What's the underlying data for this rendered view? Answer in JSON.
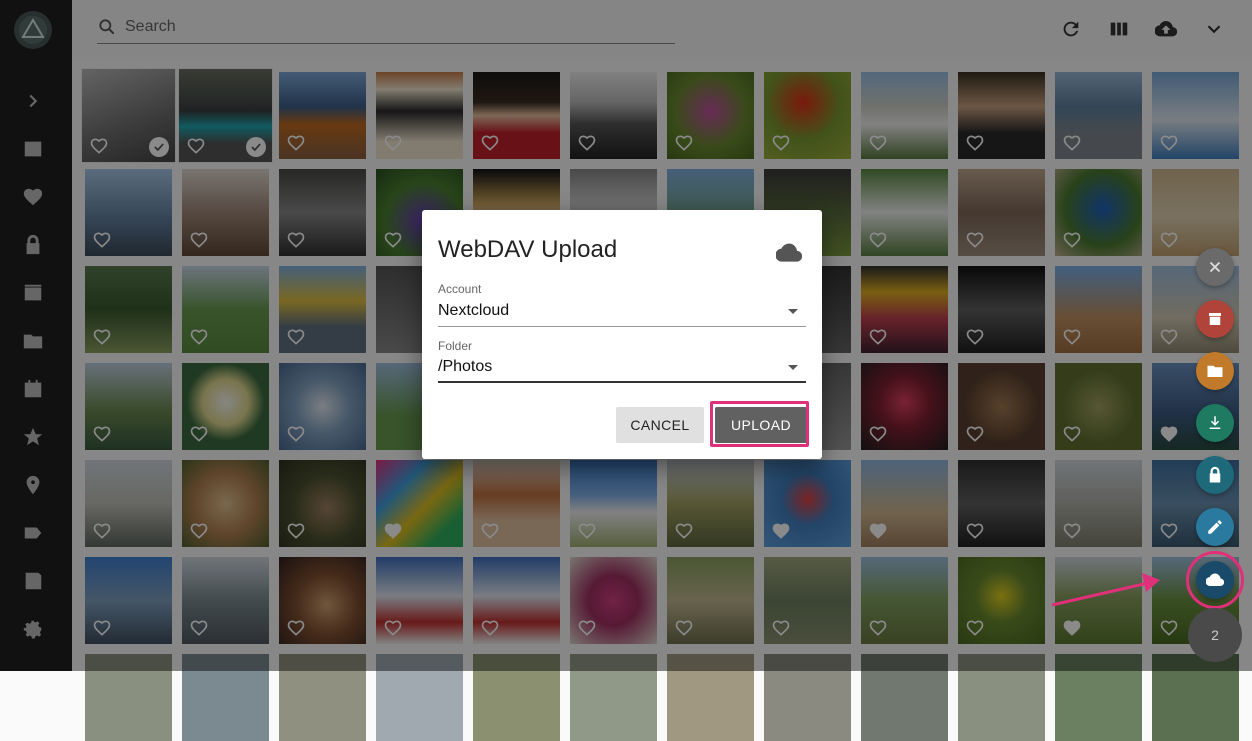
{
  "search": {
    "placeholder": "Search"
  },
  "sidebar": {
    "items": [
      "chevron-right",
      "photos",
      "favorites",
      "private",
      "videos",
      "folders",
      "calendar",
      "moments",
      "places",
      "labels",
      "library",
      "settings"
    ]
  },
  "toolbar": {
    "tools": [
      "refresh",
      "view-columns",
      "upload",
      "more"
    ]
  },
  "dialog": {
    "title": "WebDAV Upload",
    "account_label": "Account",
    "account_value": "Nextcloud",
    "folder_label": "Folder",
    "folder_value": "/Photos",
    "cancel_label": "CANCEL",
    "upload_label": "UPLOAD"
  },
  "fab_count": "2",
  "colors": {
    "accent_highlight": "#e0307a",
    "sidebar_bg": "#212121",
    "upload_button": "#616161"
  }
}
